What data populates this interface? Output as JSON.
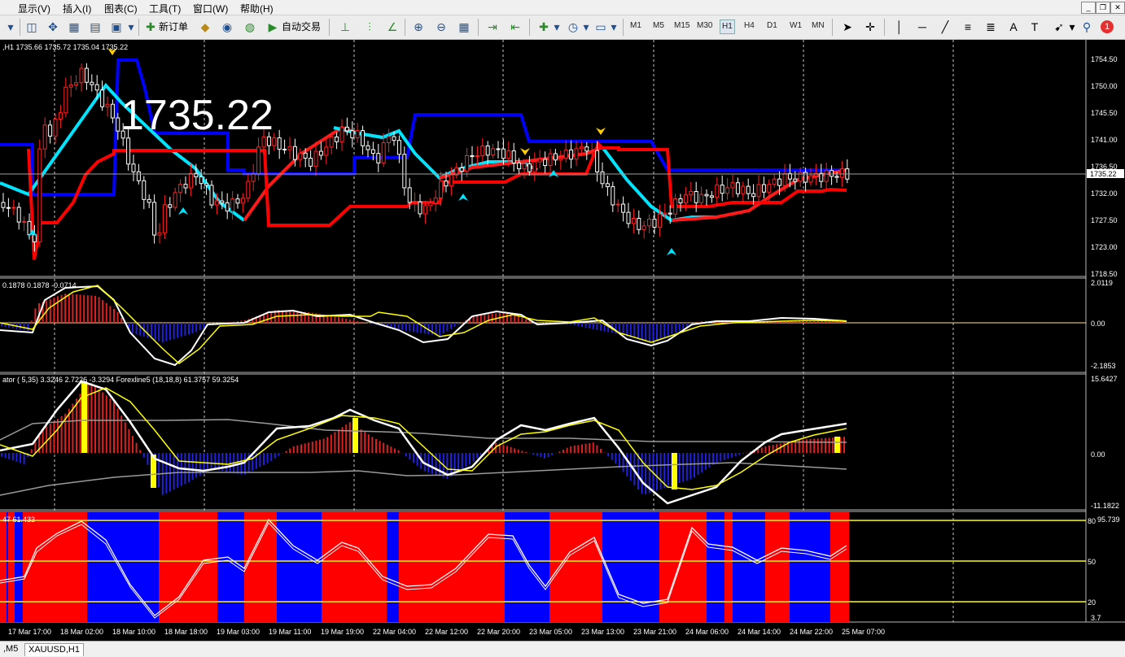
{
  "menu": {
    "items": [
      "显示(V)",
      "插入(I)",
      "图表(C)",
      "工具(T)",
      "窗口(W)",
      "帮助(H)"
    ]
  },
  "toolbar": {
    "new_order": "新订单",
    "auto_trading": "自动交易",
    "timeframes": [
      "M1",
      "M5",
      "M15",
      "M30",
      "H1",
      "H4",
      "D1",
      "W1",
      "MN"
    ],
    "active_timeframe": "H1",
    "notifications_badge": "1"
  },
  "chart": {
    "header": ",H1  1735.66 1735.72 1735.04 1735.22",
    "big_price": "1735.22",
    "current_price": "1735.22",
    "price_axis": [
      "1754.50",
      "1750.00",
      "1745.50",
      "1741.00",
      "1736.50",
      "1732.00",
      "1727.50",
      "1723.00",
      "1718.50"
    ],
    "colors": {
      "bull": "#ff2020",
      "bear": "#ffffff",
      "upper_band": "#0000ff",
      "lower_band": "#ff0000",
      "midline": "#00e5ff",
      "signal": "#ffff00"
    }
  },
  "panel2": {
    "header": "0.1878 0.1878 -0.0714",
    "axis": [
      "2.0119",
      "0.00",
      "-2.1853"
    ]
  },
  "panel3": {
    "header": "ator ( 5,35) 3.3246 2.7226 -3.3294   Forexline5 (18,18,8) 61.3757 59.3254",
    "axis": [
      "15.6427",
      "0.00",
      "-11.1822"
    ]
  },
  "panel4": {
    "header": "47 61.433",
    "axis": [
      "95.739",
      "80",
      "50",
      "20",
      "3.7"
    ]
  },
  "time_axis": [
    "17 Mar 17:00",
    "18 Mar 02:00",
    "18 Mar 10:00",
    "18 Mar 18:00",
    "19 Mar 03:00",
    "19 Mar 11:00",
    "19 Mar 19:00",
    "22 Mar 04:00",
    "22 Mar 12:00",
    "22 Mar 20:00",
    "23 Mar 05:00",
    "23 Mar 13:00",
    "23 Mar 21:00",
    "24 Mar 06:00",
    "24 Mar 14:00",
    "24 Mar 22:00",
    "25 Mar 07:00"
  ],
  "status": {
    "tabs": [
      ",M5",
      "XAUUSD,H1"
    ],
    "active_tab": "XAUUSD,H1"
  }
}
